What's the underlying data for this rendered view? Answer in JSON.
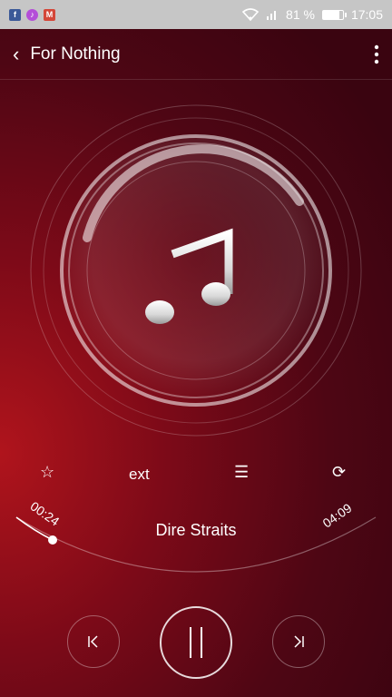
{
  "status_bar": {
    "notifications": [
      "facebook-icon",
      "music-icon",
      "gmail-icon"
    ],
    "battery_percent": "81 %",
    "battery_level": 0.81,
    "time": "17:05"
  },
  "app_bar": {
    "title": "For Nothing"
  },
  "actions": {
    "lyrics_label": "ext"
  },
  "player": {
    "elapsed": "00:24",
    "total": "04:09",
    "artist": "Dire Straits",
    "progress": 0.096
  },
  "colors": {
    "accent": "#b0141c",
    "background_dark": "#3a0410"
  }
}
